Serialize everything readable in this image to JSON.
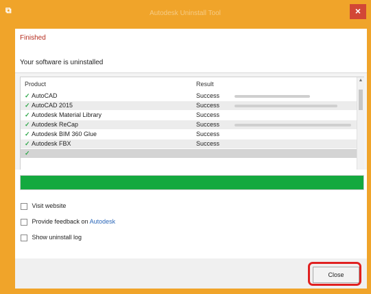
{
  "window": {
    "title": "Autodesk Uninstall Tool",
    "icon": "app-icon",
    "close_glyph": "×"
  },
  "header": {
    "title": "Finished",
    "subtitle": "Your software is uninstalled"
  },
  "list": {
    "columns": [
      "Product",
      "Result"
    ],
    "rows": [
      {
        "name": "AutoCAD",
        "status": "Success"
      },
      {
        "name": "AutoCAD 2015",
        "status": "Success"
      },
      {
        "name": "Autodesk Material Library",
        "status": "Success"
      },
      {
        "name": "Autodesk ReCap",
        "status": "Success"
      },
      {
        "name": "Autodesk BIM 360 Glue",
        "status": "Success"
      },
      {
        "name": "Autodesk FBX",
        "status": "Success"
      },
      {
        "name": "",
        "status": ""
      }
    ]
  },
  "progress": {
    "fraction": 1.0,
    "color": "#14a93f"
  },
  "options": [
    {
      "label": "Visit website",
      "link": ""
    },
    {
      "label": "Provide feedback on",
      "link": "Autodesk"
    },
    {
      "label": "Show uninstall log",
      "link": ""
    }
  ],
  "footer": {
    "close_label": "Close"
  }
}
